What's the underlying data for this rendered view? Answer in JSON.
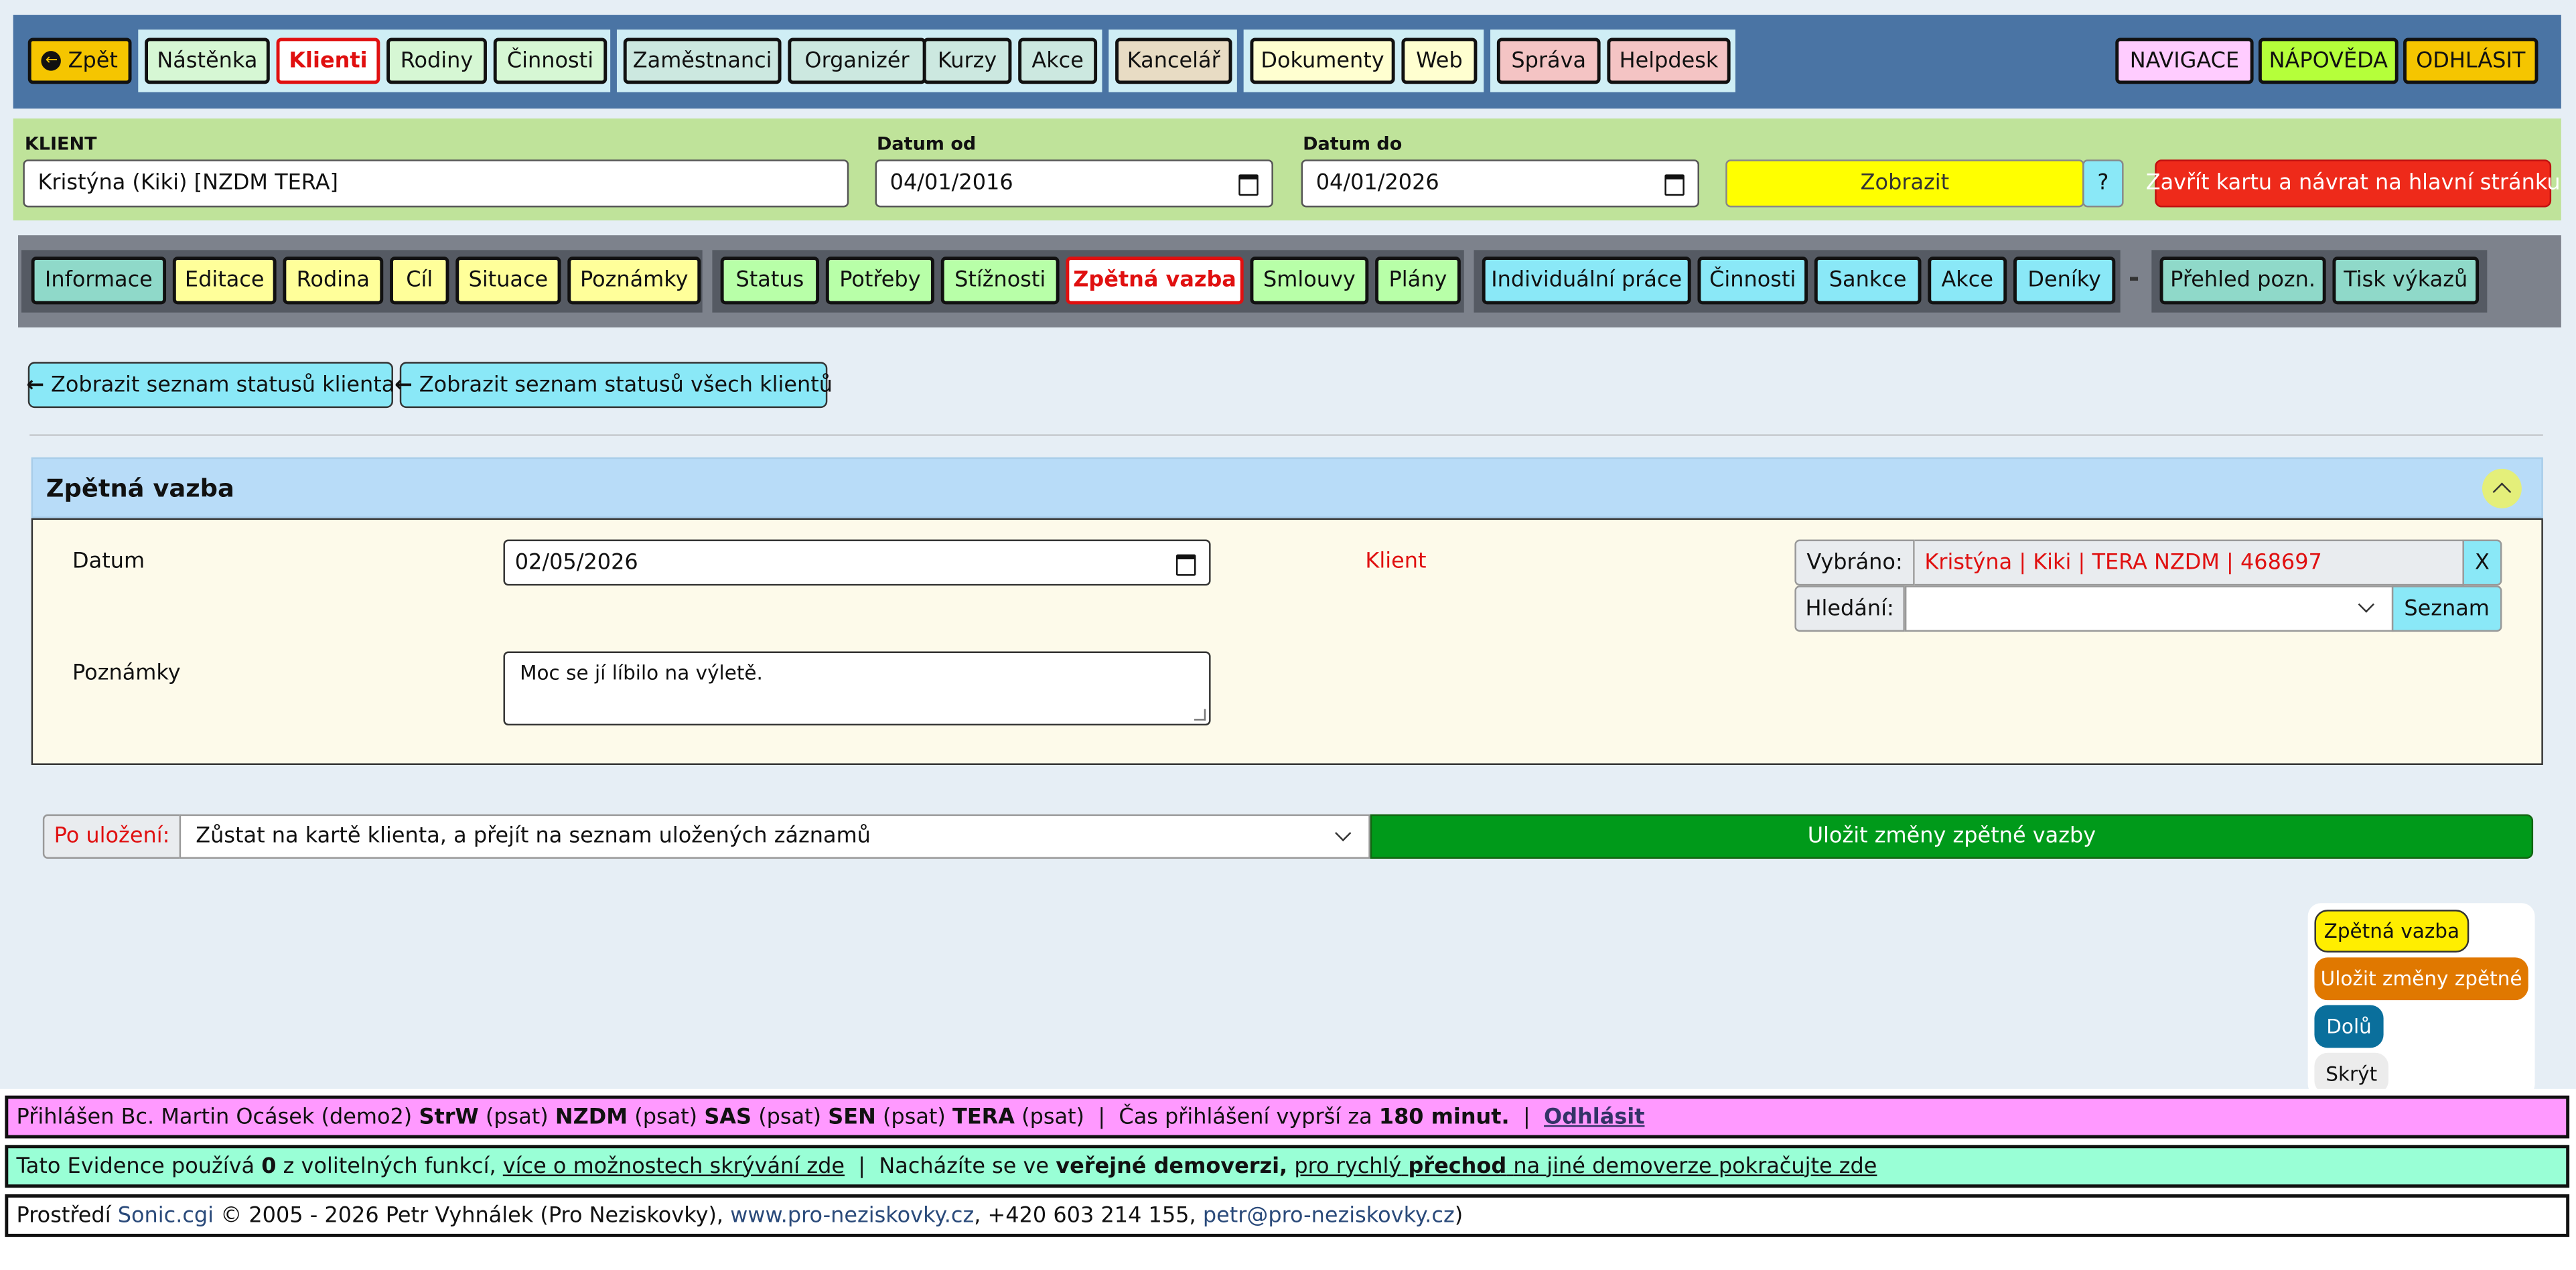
{
  "topnav": {
    "back": "Zpět",
    "items": [
      "Nástěnka",
      "Klienti",
      "Rodiny",
      "Činnosti",
      "Zaměstnanci",
      "Organizér",
      "Kurzy",
      "Akce",
      "Kancelář",
      "Dokumenty",
      "Web",
      "Správa",
      "Helpdesk"
    ],
    "right": [
      "NAVIGACE",
      "NÁPOVĚDA",
      "ODHLÁSIT"
    ]
  },
  "clientbar": {
    "klient_label": "KLIENT",
    "klient_value": "Kristýna (Kiki) [NZDM TERA]",
    "datum_od_label": "Datum od",
    "datum_od_value": "04/01/2016",
    "datum_do_label": "Datum do",
    "datum_do_value": "04/01/2026",
    "zobrazit": "Zobrazit",
    "help": "?",
    "close": "Zavřít kartu a návrat na hlavní stránku"
  },
  "subnav": {
    "items": [
      "Informace",
      "Editace",
      "Rodina",
      "Cíl",
      "Situace",
      "Poznámky",
      "Status",
      "Potřeby",
      "Stížnosti",
      "Zpětná vazba",
      "Smlouvy",
      "Plány",
      "Individuální práce",
      "Činnosti",
      "Sankce",
      "Akce",
      "Deníky",
      "Přehled pozn.",
      "Tisk výkazů"
    ],
    "separator": "-"
  },
  "actions": {
    "status_client": "Zobrazit seznam statusů klienta",
    "status_all": "Zobrazit seznam statusů všech klientů"
  },
  "form": {
    "title": "Zpětná vazba",
    "datum_label": "Datum",
    "datum_value": "02/05/2026",
    "klient_label": "Klient",
    "vybrano_label": "Vybráno:",
    "vybrano_value": "Kristýna | Kiki | TERA NZDM | 468697",
    "vybrano_clear": "X",
    "hledani_label": "Hledání:",
    "seznam": "Seznam",
    "poznamky_label": "Poznámky",
    "poznamky_value": "Moc se jí líbilo na výletě."
  },
  "save": {
    "after_label": "Po uložení:",
    "after_value": "Zůstat na kartě klienta, a přejít na seznam uložených záznamů",
    "submit": "Uložit změny zpětné vazby"
  },
  "floating": {
    "items": [
      "Zpětná vazba",
      "Uložit změny zpětné",
      "Dolů",
      "Skrýt"
    ]
  },
  "footer": {
    "line1": {
      "prefix": "Přihlášen Bc. Martin Ocásek (demo2)",
      "strw": "StrW",
      "psat1": "(psat)",
      "nzdm": "NZDM",
      "psat2": "(psat)",
      "sas": "SAS",
      "psat3": "(psat)",
      "sen": "SEN",
      "psat4": "(psat)",
      "tera": "TERA",
      "psat5": "(psat)",
      "sep": "|",
      "time_prefix": "Čas přihlášení vyprší za",
      "time_value": "180 minut.",
      "logout": "Odhlásit"
    },
    "line2": {
      "p1": "Tato Evidence používá",
      "count": "0",
      "p2": "z volitelných funkcí,",
      "link1": "více o možnostech skrývání zde",
      "sep": "|",
      "p3": "Nacházíte se ve",
      "demo": "veřejné demoverzi,",
      "link2a": "pro rychlý",
      "link2b": "přechod",
      "link2c": "na jiné demoverze pokračujte zde"
    },
    "line3": {
      "p1": "Prostředí",
      "sonic": "Sonic.cgi",
      "p2": "© 2005 - 2026 Petr Vyhnálek (Pro Neziskovky),",
      "web": "www.pro-neziskovky.cz",
      "p3": ", +420 603 214 155,",
      "mail": "petr@pro-neziskovky.cz",
      "p4": ")"
    }
  },
  "colors": {
    "topnav_bg": "#4a74a4",
    "clientbar_bg": "#bfe39a",
    "subnav_bg": "#7d828c",
    "save_green": "#009a1a",
    "close_red": "#ee2a1a",
    "footer_pink": "#ff99ff",
    "footer_mint": "#99ffd6"
  }
}
